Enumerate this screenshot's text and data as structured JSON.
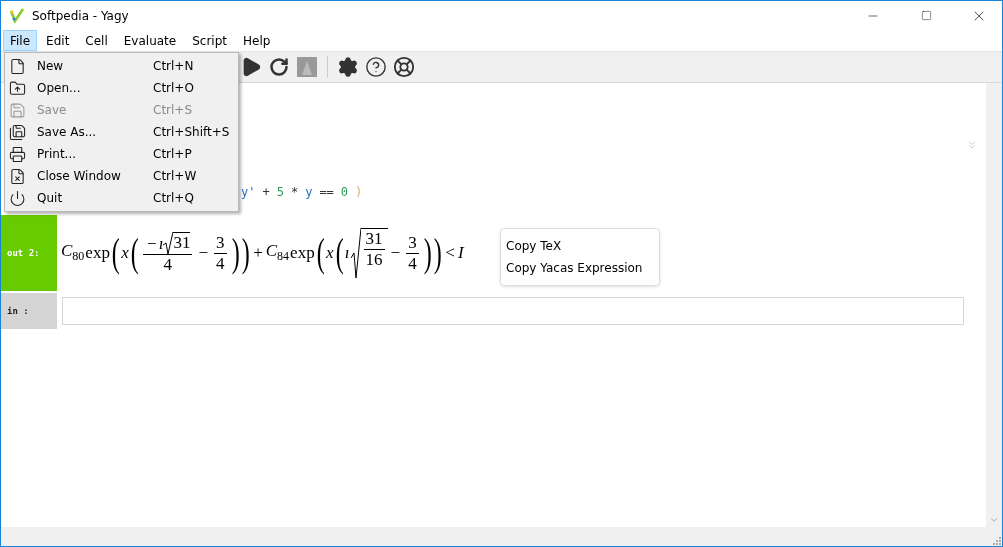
{
  "window": {
    "title": "Softpedia - Yagy"
  },
  "menubar": [
    {
      "label": "File",
      "selected": true
    },
    {
      "label": "Edit",
      "selected": false
    },
    {
      "label": "Cell",
      "selected": false
    },
    {
      "label": "Evaluate",
      "selected": false
    },
    {
      "label": "Script",
      "selected": false
    },
    {
      "label": "Help",
      "selected": false
    }
  ],
  "file_menu": [
    {
      "label": "New",
      "shortcut": "Ctrl+N",
      "disabled": false
    },
    {
      "label": "Open...",
      "shortcut": "Ctrl+O",
      "disabled": false
    },
    {
      "label": "Save",
      "shortcut": "Ctrl+S",
      "disabled": true
    },
    {
      "label": "Save As...",
      "shortcut": "Ctrl+Shift+S",
      "disabled": false
    },
    {
      "label": "Print...",
      "shortcut": "Ctrl+P",
      "disabled": false
    },
    {
      "label": "Close Window",
      "shortcut": "Ctrl+W",
      "disabled": false
    },
    {
      "label": "Quit",
      "shortcut": "Ctrl+Q",
      "disabled": false
    }
  ],
  "input_code": [
    {
      "kind": "variable",
      "text": "y'"
    },
    {
      "kind": "operator",
      "text": "+"
    },
    {
      "kind": "number",
      "text": "5"
    },
    {
      "kind": "operator",
      "text": "*"
    },
    {
      "kind": "variable",
      "text": "y"
    },
    {
      "kind": "operator",
      "text": "=="
    },
    {
      "kind": "number",
      "text": "0"
    },
    {
      "kind": "paren",
      "text": ")"
    }
  ],
  "output_cell": {
    "label": "out 2:",
    "formula": [
      {
        "kind": "var",
        "text": "C",
        "sub": "80"
      },
      {
        "kind": "fn",
        "text": "exp"
      },
      {
        "kind": "paren",
        "text": "("
      },
      {
        "kind": "var",
        "text": "x"
      },
      {
        "kind": "paren",
        "text": "("
      },
      {
        "kind": "frac",
        "num": [
          {
            "kind": "op",
            "text": "−"
          },
          {
            "kind": "var",
            "text": "ı"
          },
          {
            "kind": "sqrt",
            "text": "31"
          }
        ],
        "den": "4"
      },
      {
        "kind": "op",
        "text": "−"
      },
      {
        "kind": "frac",
        "num": [
          {
            "kind": "fn",
            "text": "3"
          }
        ],
        "den": "4"
      },
      {
        "kind": "paren",
        "text": ")"
      },
      {
        "kind": "paren",
        "text": ")"
      },
      {
        "kind": "op",
        "text": "+"
      },
      {
        "kind": "var",
        "text": "C",
        "sub": "84"
      },
      {
        "kind": "fn",
        "text": "exp"
      },
      {
        "kind": "paren",
        "text": "("
      },
      {
        "kind": "var",
        "text": "x"
      },
      {
        "kind": "paren",
        "text": "("
      },
      {
        "kind": "var",
        "text": "ı"
      },
      {
        "kind": "sqrtfrac",
        "num": "31",
        "den": "16"
      },
      {
        "kind": "op",
        "text": "−"
      },
      {
        "kind": "frac",
        "num": [
          {
            "kind": "fn",
            "text": "3"
          }
        ],
        "den": "4"
      },
      {
        "kind": "paren",
        "text": ")"
      },
      {
        "kind": "paren",
        "text": ")"
      },
      {
        "kind": "op",
        "text": "<"
      },
      {
        "kind": "var",
        "text": "I"
      }
    ]
  },
  "input_cell": {
    "label": "in  :"
  },
  "context_menu": [
    "Copy TeX",
    "Copy Yacas Expression"
  ]
}
